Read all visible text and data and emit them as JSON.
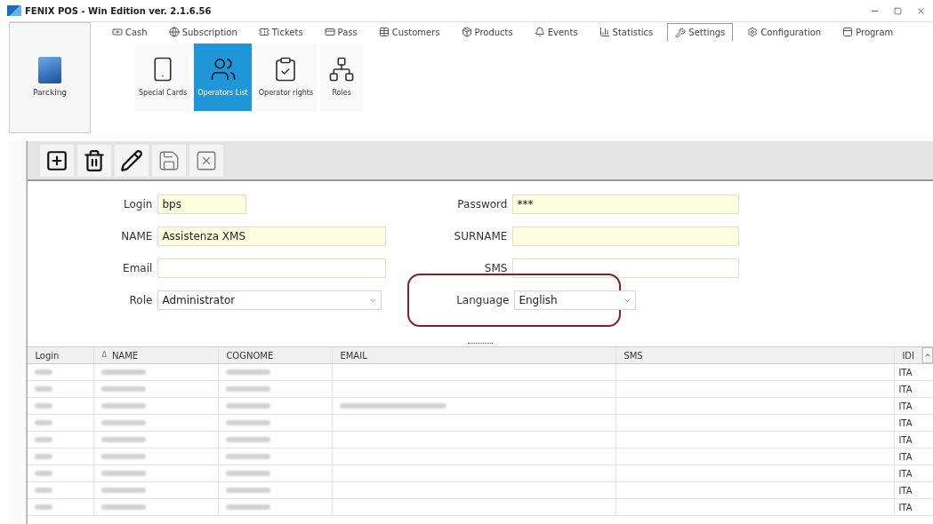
{
  "window": {
    "title": "FENIX POS - Win Edition ver. 2.1.6.56"
  },
  "app_tile": {
    "label": "Parcking"
  },
  "tabs": [
    {
      "label": "Cash",
      "selected": false
    },
    {
      "label": "Subscription",
      "selected": false
    },
    {
      "label": "Tickets",
      "selected": false
    },
    {
      "label": "Pass",
      "selected": false
    },
    {
      "label": "Customers",
      "selected": false
    },
    {
      "label": "Products",
      "selected": false
    },
    {
      "label": "Events",
      "selected": false
    },
    {
      "label": "Statistics",
      "selected": false
    },
    {
      "label": "Settings",
      "selected": true
    },
    {
      "label": "Configuration",
      "selected": false
    },
    {
      "label": "Program",
      "selected": false
    }
  ],
  "ribbon_buttons": [
    {
      "label": "Special Cards",
      "selected": false
    },
    {
      "label": "Operators List",
      "selected": true
    },
    {
      "label": "Operator rights",
      "selected": false
    },
    {
      "label": "Roles",
      "selected": false
    }
  ],
  "toolbar": [
    {
      "disabled": false
    },
    {
      "disabled": false
    },
    {
      "disabled": false
    },
    {
      "disabled": true
    },
    {
      "disabled": true
    }
  ],
  "form": {
    "left": [
      {
        "label": "Login",
        "value": "bps",
        "kind": "short",
        "required": true
      },
      {
        "label": "NAME",
        "value": "Assistenza XMS",
        "kind": "text",
        "required": true
      },
      {
        "label": "Email",
        "kind": "text",
        "required": false
      },
      {
        "label": "Role",
        "value": "Administrator",
        "kind": "select",
        "required": false
      }
    ],
    "right": [
      {
        "label": "Password",
        "value": "***",
        "kind": "text",
        "required": true
      },
      {
        "label": "SURNAME",
        "kind": "text",
        "required": true
      },
      {
        "label": "SMS",
        "kind": "text",
        "required": false
      },
      {
        "label": "Language",
        "value": "English",
        "kind": "select",
        "required": false,
        "highlighted": true
      }
    ]
  },
  "table": {
    "columns": [
      {
        "label": "Login",
        "sorted": false
      },
      {
        "label": "NAME",
        "sorted": true
      },
      {
        "label": "COGNOME",
        "sorted": false
      },
      {
        "label": "EMAIL",
        "sorted": false
      },
      {
        "label": "SMS",
        "sorted": false
      },
      {
        "label": "IDI",
        "sorted": false
      }
    ],
    "sort_marker": "Δ",
    "rows": [
      {
        "redacted": [
          true,
          true,
          true,
          false,
          false
        ],
        "language": "ITA"
      },
      {
        "redacted": [
          true,
          true,
          true,
          false,
          false
        ],
        "language": "ITA"
      },
      {
        "redacted": [
          true,
          true,
          true,
          true,
          false
        ],
        "language": "ITA"
      },
      {
        "redacted": [
          true,
          true,
          true,
          false,
          false
        ],
        "language": "ITA"
      },
      {
        "redacted": [
          true,
          true,
          true,
          false,
          false
        ],
        "language": "ITA"
      },
      {
        "redacted": [
          true,
          true,
          true,
          false,
          false
        ],
        "language": "ITA"
      },
      {
        "redacted": [
          true,
          true,
          true,
          false,
          false
        ],
        "language": "ITA"
      },
      {
        "redacted": [
          true,
          true,
          true,
          false,
          false
        ],
        "language": "ITA"
      },
      {
        "redacted": [
          true,
          true,
          true,
          false,
          false
        ],
        "language": "ITA"
      }
    ]
  }
}
